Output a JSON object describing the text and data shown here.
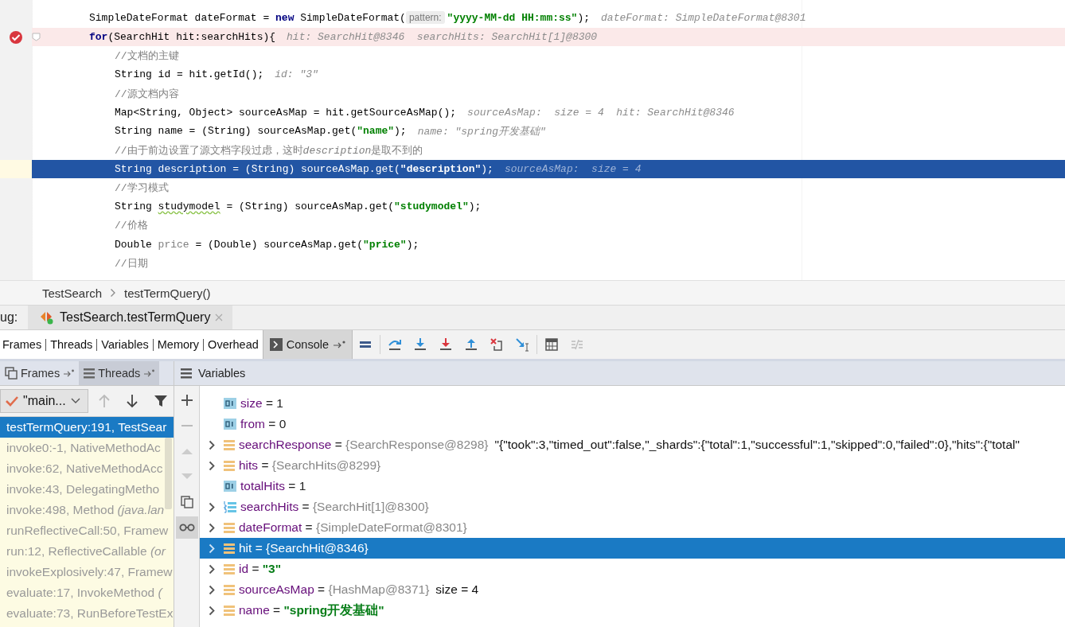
{
  "editor": {
    "lines": [
      {
        "breakpoint": false,
        "current": false,
        "code": [
          {
            "kind": "plain",
            "text": "SimpleDateFormat dateFormat = "
          },
          {
            "kind": "keyword",
            "text": "new"
          },
          {
            "kind": "plain",
            "text": " SimpleDateFormat("
          },
          {
            "kind": "param",
            "text": "pattern:"
          },
          {
            "kind": "string",
            "text": "\"yyyy-MM-dd HH:mm:ss\""
          },
          {
            "kind": "plain",
            "text": ");"
          }
        ],
        "hint": "dateFormat: SimpleDateFormat@8301"
      },
      {
        "breakpoint": true,
        "current": false,
        "code": [
          {
            "kind": "keyword",
            "text": "for"
          },
          {
            "kind": "plain",
            "text": "(SearchHit hit:searchHits){"
          }
        ],
        "hint": "hit: SearchHit@8346  searchHits: SearchHit[1]@8300",
        "children": [
          {
            "breakpoint": false,
            "current": false,
            "code": [
              {
                "kind": "comment",
                "text": "//文档的主键"
              }
            ]
          },
          {
            "breakpoint": false,
            "current": false,
            "code": [
              {
                "kind": "plain",
                "text": "String id = hit.getId();"
              }
            ],
            "hint": "id: \"3\""
          },
          {
            "breakpoint": false,
            "current": false,
            "code": [
              {
                "kind": "comment",
                "text": "//源文档内容"
              }
            ]
          },
          {
            "breakpoint": false,
            "current": false,
            "code": [
              {
                "kind": "plain",
                "text": "Map<String, Object> sourceAsMap = hit.getSourceAsMap();"
              }
            ],
            "hint": "sourceAsMap:  size = 4  hit: SearchHit@8346"
          },
          {
            "breakpoint": false,
            "current": false,
            "code": [
              {
                "kind": "plain",
                "text": "String name = (String) sourceAsMap.get("
              },
              {
                "kind": "string",
                "text": "\"name\""
              },
              {
                "kind": "plain",
                "text": ");"
              }
            ],
            "hint": "name: \"spring开发基础\""
          },
          {
            "breakpoint": false,
            "current": false,
            "code": [
              {
                "kind": "comment",
                "text": "//由于前边设置了源文档字段过虑，这时"
              },
              {
                "kind": "comment_italic",
                "text": "description"
              },
              {
                "kind": "comment",
                "text": "是取不到的"
              }
            ]
          },
          {
            "breakpoint": false,
            "current": true,
            "code": [
              {
                "kind": "plain",
                "text": "String description = (String) sourceAsMap.get("
              },
              {
                "kind": "string",
                "text": "\"description\""
              },
              {
                "kind": "plain",
                "text": ");"
              }
            ],
            "hint": "sourceAsMap:  size = 4"
          },
          {
            "breakpoint": false,
            "current": false,
            "code": [
              {
                "kind": "comment",
                "text": "//学习模式"
              }
            ]
          },
          {
            "breakpoint": false,
            "current": false,
            "code": [
              {
                "kind": "plain",
                "text": "String "
              },
              {
                "kind": "warning",
                "text": "studymodel"
              },
              {
                "kind": "plain",
                "text": " = (String) sourceAsMap.get("
              },
              {
                "kind": "string",
                "text": "\"studymodel\""
              },
              {
                "kind": "plain",
                "text": ");"
              }
            ]
          },
          {
            "breakpoint": false,
            "current": false,
            "code": [
              {
                "kind": "comment",
                "text": "//价格"
              }
            ]
          },
          {
            "breakpoint": false,
            "current": false,
            "code": [
              {
                "kind": "plain",
                "text": "Double "
              },
              {
                "kind": "unused",
                "text": "price"
              },
              {
                "kind": "plain",
                "text": " = (Double) sourceAsMap.get("
              },
              {
                "kind": "string",
                "text": "\"price\""
              },
              {
                "kind": "plain",
                "text": ");"
              }
            ]
          },
          {
            "breakpoint": false,
            "current": false,
            "code": [
              {
                "kind": "comment",
                "text": "//日期"
              }
            ]
          }
        ]
      }
    ]
  },
  "breadcrumb": [
    "TestSearch",
    "testTermQuery()"
  ],
  "debug": {
    "label": "ug:",
    "tabs": [
      {
        "label": "TestSearch.testTermQuery",
        "selected": true
      }
    ]
  },
  "view_tabs": [
    "Frames",
    "Threads",
    "Variables",
    "Memory",
    "Overhead"
  ],
  "console": {
    "label": "Console"
  },
  "toolbar": [
    {
      "kind": "layout",
      "disabled": false
    },
    {
      "kind": "over",
      "disabled": false
    },
    {
      "kind": "into",
      "disabled": false
    },
    {
      "kind": "force",
      "disabled": false
    },
    {
      "kind": "out",
      "disabled": false
    },
    {
      "kind": "drop",
      "disabled": false
    },
    {
      "kind": "cursor",
      "disabled": false
    },
    {
      "kind": "evaluate",
      "disabled": false
    },
    {
      "kind": "trace",
      "disabled": true
    }
  ],
  "panels": {
    "tabs": [
      {
        "label": "Frames",
        "selected": false
      },
      {
        "label": "Threads",
        "selected": true
      }
    ],
    "variables_title": "Variables"
  },
  "thread_selector": {
    "value": "\"main..."
  },
  "frames": [
    {
      "text": "testTermQuery:191, TestSear",
      "selected": true
    },
    {
      "text": "invoke0:-1, NativeMethodAc",
      "selected": false
    },
    {
      "text": "invoke:62, NativeMethodAcc",
      "selected": false
    },
    {
      "text": "invoke:43, DelegatingMetho",
      "selected": false
    },
    {
      "text": "invoke:498, Method *(java.lan*",
      "selected": false
    },
    {
      "text": "runReflectiveCall:50, Framew",
      "selected": false
    },
    {
      "text": "run:12, ReflectiveCallable *(or*",
      "selected": false
    },
    {
      "text": "invokeExplosively:47, Framew",
      "selected": false
    },
    {
      "text": "evaluate:17, InvokeMethod *(*",
      "selected": false
    },
    {
      "text": "evaluate:73, RunBeforeTestEx",
      "selected": false
    }
  ],
  "variables": [
    {
      "kind": "primitive",
      "expandable": false,
      "selected": false,
      "name": "size",
      "operator": "=",
      "value": "1"
    },
    {
      "kind": "primitive",
      "expandable": false,
      "selected": false,
      "name": "from",
      "operator": "=",
      "value": "0"
    },
    {
      "kind": "object",
      "expandable": true,
      "selected": false,
      "name": "searchResponse",
      "operator": "=",
      "value": "{SearchResponse@8298}",
      "extra": "\"{\"took\":3,\"timed_out\":false,\"_shards\":{\"total\":1,\"successful\":1,\"skipped\":0,\"failed\":0},\"hits\":{\"total\""
    },
    {
      "kind": "object",
      "expandable": true,
      "selected": false,
      "name": "hits",
      "operator": "=",
      "value": "{SearchHits@8299}"
    },
    {
      "kind": "primitive",
      "expandable": false,
      "selected": false,
      "name": "totalHits",
      "operator": "=",
      "value": "1"
    },
    {
      "kind": "array",
      "expandable": true,
      "selected": false,
      "name": "searchHits",
      "operator": "=",
      "value": "{SearchHit[1]@8300}"
    },
    {
      "kind": "object",
      "expandable": true,
      "selected": false,
      "name": "dateFormat",
      "operator": "=",
      "value": "{SimpleDateFormat@8301}"
    },
    {
      "kind": "object",
      "expandable": true,
      "selected": true,
      "name": "hit",
      "operator": "=",
      "value": "{SearchHit@8346}"
    },
    {
      "kind": "string",
      "expandable": true,
      "selected": false,
      "name": "id",
      "operator": "=",
      "value": "\"3\""
    },
    {
      "kind": "object",
      "expandable": true,
      "selected": false,
      "name": "sourceAsMap",
      "operator": "=",
      "value": "{HashMap@8371}",
      "extra": "size = 4"
    },
    {
      "kind": "string",
      "expandable": true,
      "selected": false,
      "name": "name",
      "operator": "=",
      "value": "\"spring开发基础\""
    }
  ]
}
